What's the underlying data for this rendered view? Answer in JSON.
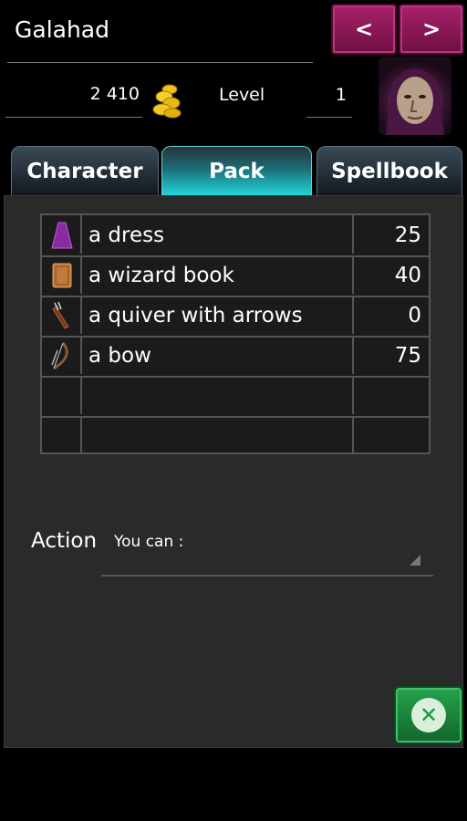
{
  "header": {
    "character_name": "Galahad",
    "prev_label": "<",
    "next_label": ">",
    "gold": "2 410",
    "gold_icon": "gold-coins-icon",
    "level_label": "Level",
    "level_value": "1",
    "portrait": "hooded-wizard-portrait"
  },
  "tabs": [
    {
      "label": "Character",
      "active": false
    },
    {
      "label": "Pack",
      "active": true
    },
    {
      "label": "Spellbook",
      "active": false
    }
  ],
  "inventory": [
    {
      "name": "a dress",
      "value": "25",
      "icon": "dress-icon",
      "color": "#8a2aa0"
    },
    {
      "name": "a wizard book",
      "value": "40",
      "icon": "book-icon",
      "color": "#c07a3a"
    },
    {
      "name": "a quiver with arrows",
      "value": "0",
      "icon": "quiver-icon",
      "color": "#7a3a22"
    },
    {
      "name": "a bow",
      "value": "75",
      "icon": "bow-icon",
      "color": "#8a5a30"
    },
    {
      "name": "",
      "value": "",
      "icon": "",
      "color": ""
    },
    {
      "name": "",
      "value": "",
      "icon": "",
      "color": ""
    }
  ],
  "action": {
    "label": "Action",
    "select_value": "You can :"
  },
  "colors": {
    "nav_button": "#8f1a58",
    "active_tab": "#24d8de",
    "close_button": "#1e8a3e"
  }
}
